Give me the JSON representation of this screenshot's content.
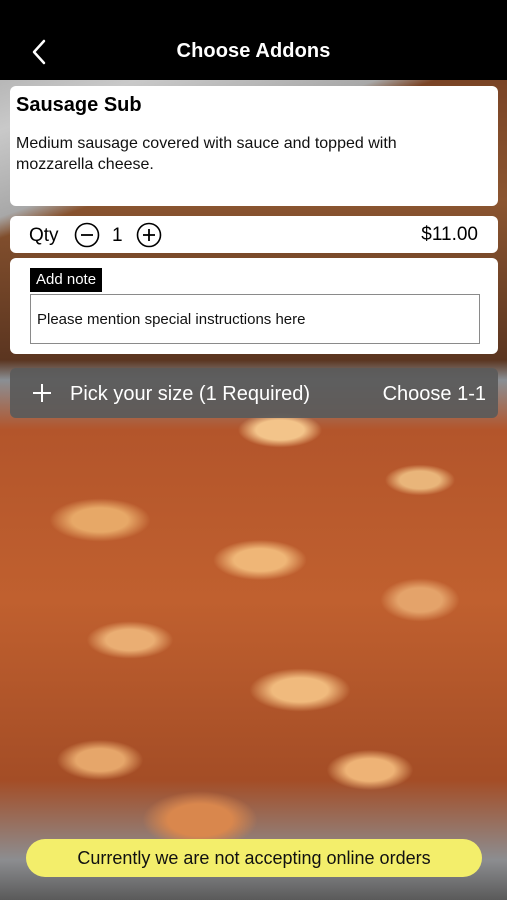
{
  "header": {
    "title": "Choose Addons",
    "back_icon": "chevron-left-icon"
  },
  "item": {
    "name": "Sausage Sub",
    "description": "Medium sausage covered with sauce and topped with mozzarella cheese."
  },
  "quantity": {
    "label": "Qty",
    "value": "1",
    "minus_icon": "minus-circle-icon",
    "plus_icon": "plus-circle-icon",
    "price": "$11.00"
  },
  "note": {
    "label": "Add note",
    "placeholder": "Please mention special instructions here",
    "value": ""
  },
  "size_section": {
    "icon": "plus-icon",
    "title": "Pick your size (1 Required)",
    "choose": "Choose 1-1"
  },
  "notice": {
    "text": "Currently we are not accepting online orders",
    "color": "#f3ee6b"
  },
  "colors": {
    "navbar": "#000000",
    "card": "#ffffff",
    "section_bar": "#5a5a5a"
  }
}
